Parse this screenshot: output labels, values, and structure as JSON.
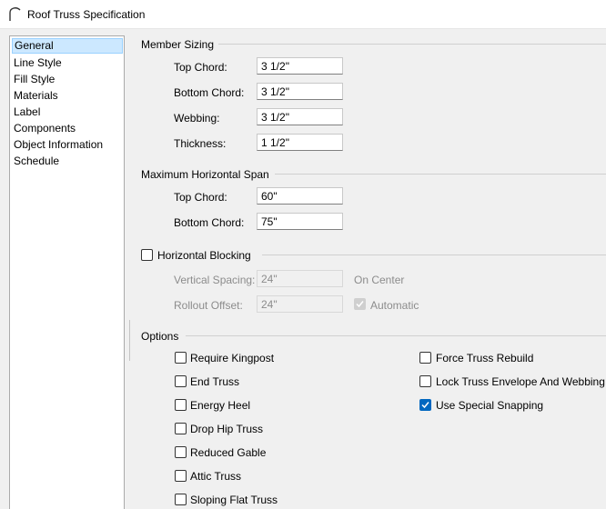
{
  "window": {
    "title": "Roof Truss Specification",
    "icon": "roof-truss-icon"
  },
  "sidebar": {
    "items": [
      {
        "label": "General",
        "selected": true
      },
      {
        "label": "Line Style"
      },
      {
        "label": "Fill Style"
      },
      {
        "label": "Materials"
      },
      {
        "label": "Label"
      },
      {
        "label": "Components"
      },
      {
        "label": "Object Information"
      },
      {
        "label": "Schedule"
      }
    ]
  },
  "member_sizing": {
    "title": "Member Sizing",
    "top_chord": {
      "label": "Top Chord:",
      "value": "3 1/2\""
    },
    "bottom_chord": {
      "label": "Bottom Chord:",
      "value": "3 1/2\""
    },
    "webbing": {
      "label": "Webbing:",
      "value": "3 1/2\""
    },
    "thickness": {
      "label": "Thickness:",
      "value": "1 1/2\""
    }
  },
  "max_span": {
    "title": "Maximum Horizontal Span",
    "top_chord": {
      "label": "Top Chord:",
      "value": "60\""
    },
    "bottom_chord": {
      "label": "Bottom Chord:",
      "value": "75\""
    }
  },
  "blocking": {
    "title": "Horizontal Blocking",
    "checked": false,
    "vertical_spacing": {
      "label": "Vertical Spacing:",
      "value": "24\"",
      "suffix": "On Center"
    },
    "rollout_offset": {
      "label": "Rollout Offset:",
      "value": "24\""
    },
    "automatic": {
      "label": "Automatic",
      "checked": true,
      "disabled": true
    }
  },
  "options": {
    "title": "Options",
    "left": [
      {
        "label": "Require Kingpost",
        "checked": false
      },
      {
        "label": "End Truss",
        "checked": false
      },
      {
        "label": "Energy Heel",
        "checked": false
      },
      {
        "label": "Drop Hip Truss",
        "checked": false
      },
      {
        "label": "Reduced Gable",
        "checked": false
      },
      {
        "label": "Attic Truss",
        "checked": false
      },
      {
        "label": "Sloping Flat Truss",
        "checked": false
      }
    ],
    "right": [
      {
        "label": "Force Truss Rebuild",
        "checked": false
      },
      {
        "label": "Lock Truss Envelope And Webbing",
        "checked": false
      },
      {
        "label": "Use Special Snapping",
        "checked": true
      }
    ]
  },
  "colors": {
    "accent": "#0067c0",
    "selection": "#cce8ff",
    "disabled_text": "#8c8c8c"
  }
}
